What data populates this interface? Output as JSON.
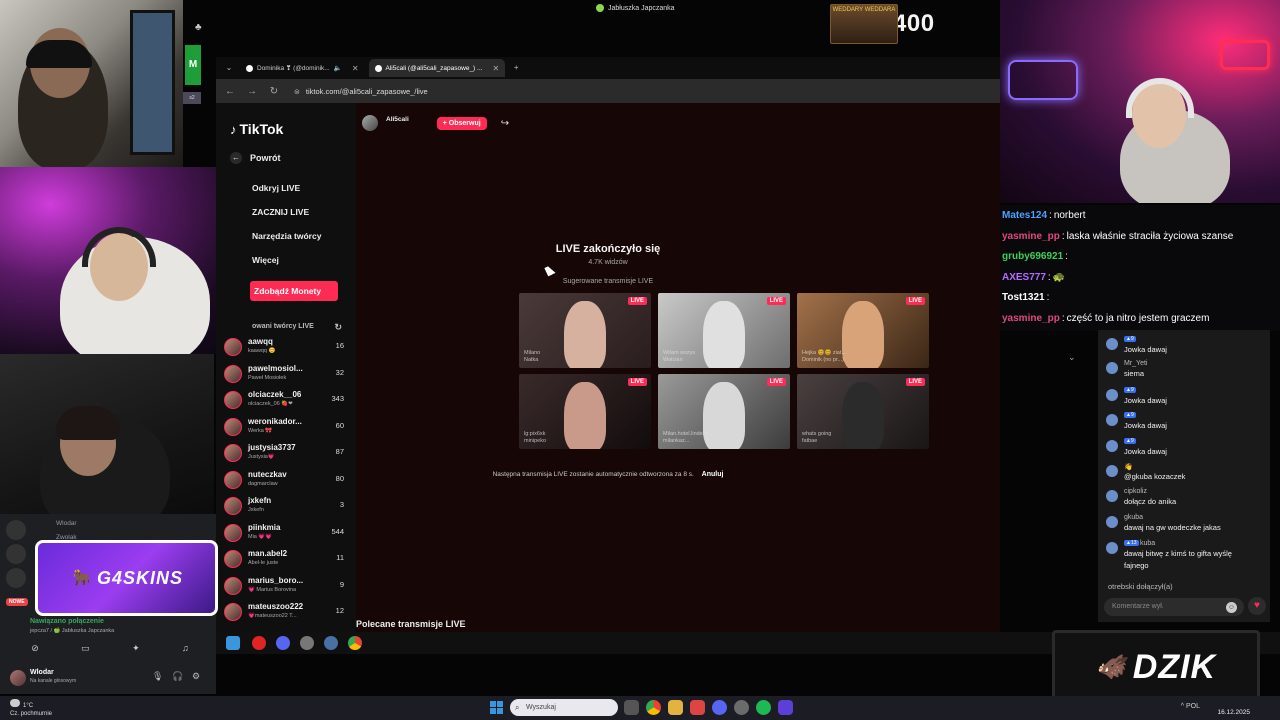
{
  "top": {
    "window_title": "Jabłuszka Japczanka",
    "counter_text": "357 / 400",
    "counter_thumb_label": "WEDDARY WEDDARA",
    "side_badge": "s2"
  },
  "browser": {
    "tabs": [
      {
        "label": "Dominika ❣ (@dominik..."
      },
      {
        "label": "Ali5cali (@ali5cali_zapasowe_) ..."
      }
    ],
    "new_tab": "+",
    "url": "tiktok.com/@ali5cali_zapasowe_/live"
  },
  "tiktok": {
    "logo": "TikTok",
    "back_label": "Powrót",
    "menu": [
      "Odkryj LIVE",
      "ZACZNIJ LIVE",
      "Narzędzia twórcy",
      "Więcej"
    ],
    "coins_button": "Zdobądź Monety",
    "creators_header": "owani twórcy LIVE",
    "creators": [
      {
        "name": "aawqq",
        "sub": "kaawqq 😊",
        "count": "16"
      },
      {
        "name": "pawelmosiol...",
        "sub": "Paweł Mosiołek",
        "count": "32"
      },
      {
        "name": "olciaczek__06",
        "sub": "olciaczek_06 🍓❤",
        "count": "343"
      },
      {
        "name": "weronikador...",
        "sub": "Werka 🎀",
        "count": "60"
      },
      {
        "name": "justysia3737",
        "sub": "Justysia💗",
        "count": "87"
      },
      {
        "name": "nuteczkav",
        "sub": "dagmarclaw",
        "count": "80"
      },
      {
        "name": "jxkefn",
        "sub": "Jxkefn",
        "count": "3"
      },
      {
        "name": "piinkmia",
        "sub": "Mia 💗💗",
        "count": "544"
      },
      {
        "name": "man.abel2",
        "sub": "Abel-le juste",
        "count": "11"
      },
      {
        "name": "marius_boro...",
        "sub": "💗 Marius Borovina",
        "count": "9"
      },
      {
        "name": "mateuszoo222",
        "sub": "💗mateuszoo22 T...",
        "count": "12"
      }
    ],
    "host_name": "Ali5cali",
    "follow_label": "+ Obserwuj",
    "share_icon": "↪",
    "ended_title": "LIVE zakończyło się",
    "viewers": "4.7K widzów",
    "suggested_label": "Sugerowane transmisje LIVE",
    "live_tag": "LIVE",
    "thumbs": [
      {
        "caption": "Milano\nNatka"
      },
      {
        "caption": "Witam wszys\nWatcian"
      },
      {
        "caption": "Hejka 😊😊 ziat...\nDominik (no pr...)"
      },
      {
        "caption": "lg:pix6xk\nminipeko"
      },
      {
        "caption": "Milan.hotel.lindeby...\nmilankaz..."
      },
      {
        "caption": "whats going\nfatbae"
      }
    ],
    "next_text": "Następna transmisja LIVE zostanie automatycznie odtworzona za 8 s.",
    "cancel_label": "Anuluj",
    "recommended": "Polecane transmisje LIVE"
  },
  "chat_overlay": {
    "lines": [
      {
        "user": "Mates124",
        "sep": ":",
        "msg": "norbert",
        "color": "#4ea1ff"
      },
      {
        "user": "yasmine_pp",
        "sep": ":",
        "msg": "laska właśnie straciła życiowa szanse",
        "color": "#e04a7a"
      },
      {
        "user": "gruby696921",
        "sep": ":",
        "msg": "",
        "color": "#3ccf5a"
      },
      {
        "user": "AXES777",
        "sep": ":",
        "msg": "🐢",
        "color": "#b36cff"
      },
      {
        "user": "Tost1321",
        "sep": ":",
        "msg": "",
        "color": "#ffffff"
      },
      {
        "user": "yasmine_pp",
        "sep": ":",
        "msg": "część to ja nitro jestem graczem",
        "color": "#e04a7a"
      }
    ]
  },
  "tiktok_chat": {
    "messages": [
      {
        "badge": "▲9",
        "name": "",
        "text": "Jowka dawaj"
      },
      {
        "badge": "",
        "name": "Mr_Yeti",
        "text": "siema"
      },
      {
        "badge": "▲9",
        "name": "",
        "text": "Jowka dawaj"
      },
      {
        "badge": "▲9",
        "name": "",
        "text": "Jowka dawaj"
      },
      {
        "badge": "▲9",
        "name": "",
        "text": "Jowka dawaj"
      },
      {
        "badge": "",
        "name": "👋",
        "text": "@gkuba kozaczek"
      },
      {
        "badge": "",
        "name": "cipkoliz",
        "text": "dołącz do anika"
      },
      {
        "badge": "",
        "name": "gkuba",
        "text": "dawaj na gw wodeczke jakas"
      },
      {
        "badge": "▲13",
        "name": "kuba",
        "text": "dawaj bitwę z kimś to gifta wyślę"
      },
      {
        "badge": "",
        "name": "",
        "text": "fajnego"
      }
    ],
    "join_text": "otrebski dołączył(a)",
    "input_placeholder": "Komentarze wył.",
    "emoji_icon": "☺",
    "heart_icon": "♥",
    "chevron": "⌄"
  },
  "discord": {
    "sponsor": "G4SKINS",
    "users": [
      "Wlodar",
      "Zwolak"
    ],
    "nowe": "NOWE",
    "connected": "Nawiązano połączenie",
    "connected_sub": "jepcza7 / 🍏 Jabłuszka Japczanka",
    "me_name": "Wlodar",
    "me_status": "Na kanale głosowym"
  },
  "dzik": {
    "logo": "DZIK"
  },
  "taskbar": {
    "weather_temp": "1°C",
    "weather_desc": "Cz. pochmurnie",
    "search_placeholder": "Wyszukaj",
    "time": "",
    "date": "16.12.2025",
    "lang": "^ POL"
  }
}
